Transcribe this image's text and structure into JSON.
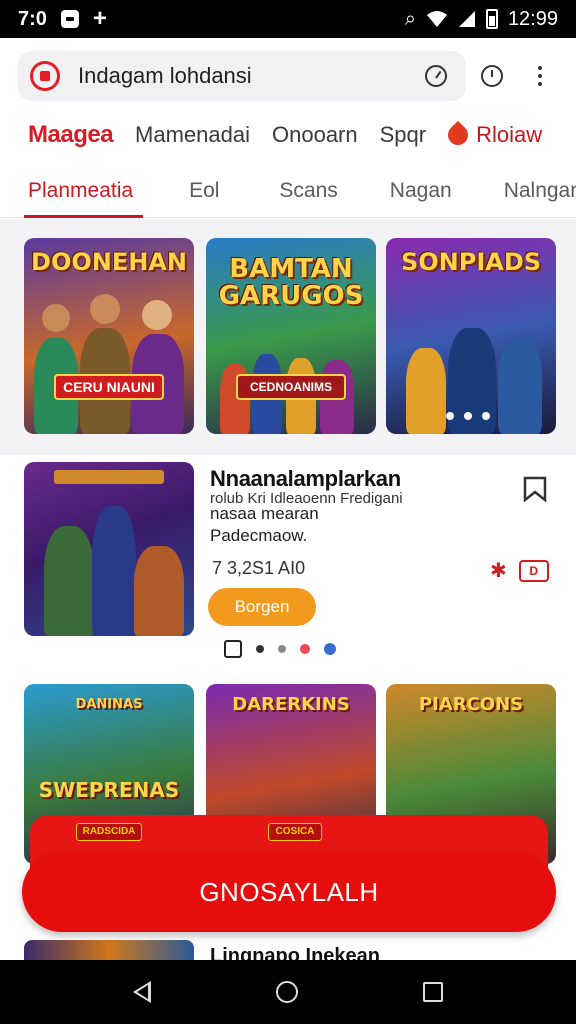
{
  "status_bar": {
    "left_time": "7:0",
    "right_time": "12:99"
  },
  "search": {
    "query": "Indagam lohdansi"
  },
  "categories": {
    "brand": "Maagea",
    "items": [
      "Mamenadai",
      "Onooarn",
      "Spqr"
    ],
    "right_label": "Rloiaw"
  },
  "tabs": [
    "Planmeatia",
    "Eol",
    "Scans",
    "Nagan",
    "Nalngan"
  ],
  "hero_cards": [
    {
      "title": "DOONEHAN",
      "banner": "CERU NIAUNI"
    },
    {
      "title": "BAMTAN GARUGOS",
      "banner": "CEDNOANIMS"
    },
    {
      "title": "SONPIADS",
      "banner": ""
    }
  ],
  "featured": {
    "title": "Nnaanalamplarkan",
    "subtitle_line1": "rolub       Kri Idleaoenn Fredigani",
    "subtitle_line2": "nasaa mearan",
    "subtitle_line3": "Padecmaow.",
    "stats": "7  3,2S1 AI0",
    "button_label": "Borgen",
    "red_box_label": "D"
  },
  "grid_cards": [
    {
      "title": "SWEPRENAS",
      "tag": "DANINAS"
    },
    {
      "title": "DARERKINS",
      "tag": ""
    },
    {
      "title": "PIARCONS",
      "tag": ""
    }
  ],
  "cta": {
    "small_tag_left": "RADSCIDA",
    "small_tag_mid": "COSICA",
    "label": "GNOSAYLALH"
  },
  "peek": {
    "title": "Lingnapo Inekean"
  },
  "colors": {
    "brand_red": "#d91a22",
    "cta_red": "#e60d0d",
    "orange_button": "#f29a1e"
  }
}
